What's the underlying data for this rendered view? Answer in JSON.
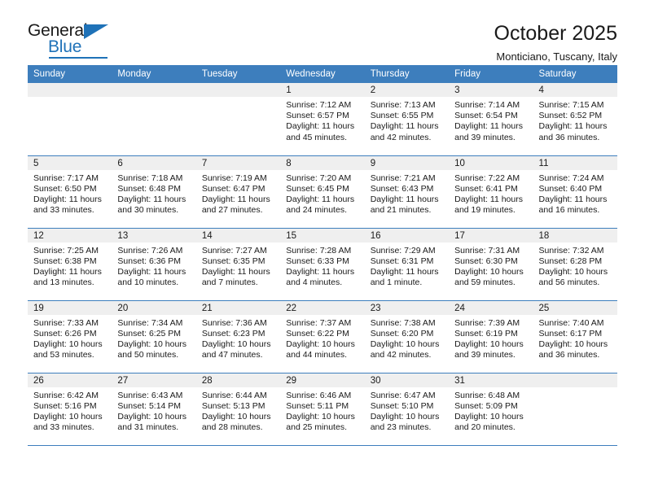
{
  "brand": {
    "name_top": "General",
    "name_bottom": "Blue",
    "accent_color": "#1f72b8"
  },
  "header": {
    "title": "October 2025",
    "subtitle": "Monticiano, Tuscany, Italy"
  },
  "theme": {
    "header_row_color": "#3d7ebd",
    "daynum_band_color": "#efefef",
    "text_color": "#1a1a1a"
  },
  "weekday_headers": [
    "Sunday",
    "Monday",
    "Tuesday",
    "Wednesday",
    "Thursday",
    "Friday",
    "Saturday"
  ],
  "weeks": [
    [
      {
        "day": "",
        "empty": true
      },
      {
        "day": "",
        "empty": true
      },
      {
        "day": "",
        "empty": true
      },
      {
        "day": "1",
        "sunrise": "Sunrise: 7:12 AM",
        "sunset": "Sunset: 6:57 PM",
        "daylight": "Daylight: 11 hours and 45 minutes."
      },
      {
        "day": "2",
        "sunrise": "Sunrise: 7:13 AM",
        "sunset": "Sunset: 6:55 PM",
        "daylight": "Daylight: 11 hours and 42 minutes."
      },
      {
        "day": "3",
        "sunrise": "Sunrise: 7:14 AM",
        "sunset": "Sunset: 6:54 PM",
        "daylight": "Daylight: 11 hours and 39 minutes."
      },
      {
        "day": "4",
        "sunrise": "Sunrise: 7:15 AM",
        "sunset": "Sunset: 6:52 PM",
        "daylight": "Daylight: 11 hours and 36 minutes."
      }
    ],
    [
      {
        "day": "5",
        "sunrise": "Sunrise: 7:17 AM",
        "sunset": "Sunset: 6:50 PM",
        "daylight": "Daylight: 11 hours and 33 minutes."
      },
      {
        "day": "6",
        "sunrise": "Sunrise: 7:18 AM",
        "sunset": "Sunset: 6:48 PM",
        "daylight": "Daylight: 11 hours and 30 minutes."
      },
      {
        "day": "7",
        "sunrise": "Sunrise: 7:19 AM",
        "sunset": "Sunset: 6:47 PM",
        "daylight": "Daylight: 11 hours and 27 minutes."
      },
      {
        "day": "8",
        "sunrise": "Sunrise: 7:20 AM",
        "sunset": "Sunset: 6:45 PM",
        "daylight": "Daylight: 11 hours and 24 minutes."
      },
      {
        "day": "9",
        "sunrise": "Sunrise: 7:21 AM",
        "sunset": "Sunset: 6:43 PM",
        "daylight": "Daylight: 11 hours and 21 minutes."
      },
      {
        "day": "10",
        "sunrise": "Sunrise: 7:22 AM",
        "sunset": "Sunset: 6:41 PM",
        "daylight": "Daylight: 11 hours and 19 minutes."
      },
      {
        "day": "11",
        "sunrise": "Sunrise: 7:24 AM",
        "sunset": "Sunset: 6:40 PM",
        "daylight": "Daylight: 11 hours and 16 minutes."
      }
    ],
    [
      {
        "day": "12",
        "sunrise": "Sunrise: 7:25 AM",
        "sunset": "Sunset: 6:38 PM",
        "daylight": "Daylight: 11 hours and 13 minutes."
      },
      {
        "day": "13",
        "sunrise": "Sunrise: 7:26 AM",
        "sunset": "Sunset: 6:36 PM",
        "daylight": "Daylight: 11 hours and 10 minutes."
      },
      {
        "day": "14",
        "sunrise": "Sunrise: 7:27 AM",
        "sunset": "Sunset: 6:35 PM",
        "daylight": "Daylight: 11 hours and 7 minutes."
      },
      {
        "day": "15",
        "sunrise": "Sunrise: 7:28 AM",
        "sunset": "Sunset: 6:33 PM",
        "daylight": "Daylight: 11 hours and 4 minutes."
      },
      {
        "day": "16",
        "sunrise": "Sunrise: 7:29 AM",
        "sunset": "Sunset: 6:31 PM",
        "daylight": "Daylight: 11 hours and 1 minute."
      },
      {
        "day": "17",
        "sunrise": "Sunrise: 7:31 AM",
        "sunset": "Sunset: 6:30 PM",
        "daylight": "Daylight: 10 hours and 59 minutes."
      },
      {
        "day": "18",
        "sunrise": "Sunrise: 7:32 AM",
        "sunset": "Sunset: 6:28 PM",
        "daylight": "Daylight: 10 hours and 56 minutes."
      }
    ],
    [
      {
        "day": "19",
        "sunrise": "Sunrise: 7:33 AM",
        "sunset": "Sunset: 6:26 PM",
        "daylight": "Daylight: 10 hours and 53 minutes."
      },
      {
        "day": "20",
        "sunrise": "Sunrise: 7:34 AM",
        "sunset": "Sunset: 6:25 PM",
        "daylight": "Daylight: 10 hours and 50 minutes."
      },
      {
        "day": "21",
        "sunrise": "Sunrise: 7:36 AM",
        "sunset": "Sunset: 6:23 PM",
        "daylight": "Daylight: 10 hours and 47 minutes."
      },
      {
        "day": "22",
        "sunrise": "Sunrise: 7:37 AM",
        "sunset": "Sunset: 6:22 PM",
        "daylight": "Daylight: 10 hours and 44 minutes."
      },
      {
        "day": "23",
        "sunrise": "Sunrise: 7:38 AM",
        "sunset": "Sunset: 6:20 PM",
        "daylight": "Daylight: 10 hours and 42 minutes."
      },
      {
        "day": "24",
        "sunrise": "Sunrise: 7:39 AM",
        "sunset": "Sunset: 6:19 PM",
        "daylight": "Daylight: 10 hours and 39 minutes."
      },
      {
        "day": "25",
        "sunrise": "Sunrise: 7:40 AM",
        "sunset": "Sunset: 6:17 PM",
        "daylight": "Daylight: 10 hours and 36 minutes."
      }
    ],
    [
      {
        "day": "26",
        "sunrise": "Sunrise: 6:42 AM",
        "sunset": "Sunset: 5:16 PM",
        "daylight": "Daylight: 10 hours and 33 minutes."
      },
      {
        "day": "27",
        "sunrise": "Sunrise: 6:43 AM",
        "sunset": "Sunset: 5:14 PM",
        "daylight": "Daylight: 10 hours and 31 minutes."
      },
      {
        "day": "28",
        "sunrise": "Sunrise: 6:44 AM",
        "sunset": "Sunset: 5:13 PM",
        "daylight": "Daylight: 10 hours and 28 minutes."
      },
      {
        "day": "29",
        "sunrise": "Sunrise: 6:46 AM",
        "sunset": "Sunset: 5:11 PM",
        "daylight": "Daylight: 10 hours and 25 minutes."
      },
      {
        "day": "30",
        "sunrise": "Sunrise: 6:47 AM",
        "sunset": "Sunset: 5:10 PM",
        "daylight": "Daylight: 10 hours and 23 minutes."
      },
      {
        "day": "31",
        "sunrise": "Sunrise: 6:48 AM",
        "sunset": "Sunset: 5:09 PM",
        "daylight": "Daylight: 10 hours and 20 minutes."
      },
      {
        "day": "",
        "empty": true
      }
    ]
  ]
}
